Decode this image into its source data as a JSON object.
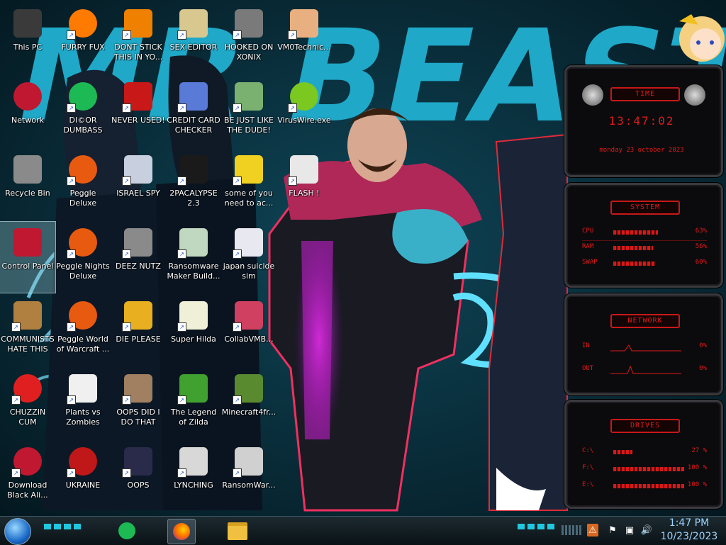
{
  "desktop": {
    "icons": [
      {
        "label": "This PC",
        "icon": "computer-icon",
        "color": "#3a3a3a"
      },
      {
        "label": "FURRY FUX",
        "icon": "firefox-icon",
        "color": "#ff7a00"
      },
      {
        "label": "DONT STICK THIS IN YO...",
        "icon": "vlc-cone-icon",
        "color": "#f08000"
      },
      {
        "label": "SEX EDITOR",
        "icon": "hxd-icon",
        "color": "#d8c890"
      },
      {
        "label": "HOOKED ON XONIX",
        "icon": "xonix-icon",
        "color": "#7a7a7a"
      },
      {
        "label": "VM0Technic...",
        "icon": "doctor-icon",
        "color": "#e8b080"
      },
      {
        "label": "Network",
        "icon": "alien-orb-icon",
        "color": "#c01830"
      },
      {
        "label": "DI©OR DUMBASS",
        "icon": "spotify-icon",
        "color": "#1db954"
      },
      {
        "label": "NEVER USED!",
        "icon": "dev-cpp-icon",
        "color": "#c81818"
      },
      {
        "label": "CREDIT CARD CHECKER",
        "icon": "credit-card-icon",
        "color": "#5a7ad8"
      },
      {
        "label": "BE JUST LIKE THE DUDE!",
        "icon": "dude-icon",
        "color": "#7ab070"
      },
      {
        "label": "VirusWire.exe",
        "icon": "lime-icon",
        "color": "#7ac820"
      },
      {
        "label": "Recycle Bin",
        "icon": "recycle-bin-icon",
        "color": "#8a8a8a"
      },
      {
        "label": "Peggle Deluxe",
        "icon": "peggle-icon",
        "color": "#e85a10"
      },
      {
        "label": "ISRAEL SPY",
        "icon": "scanner-icon",
        "color": "#c8d0e0"
      },
      {
        "label": "2PACALYPSE 2.3",
        "icon": "terminal-icon",
        "color": "#1a1a1a"
      },
      {
        "label": "some of you need to ac...",
        "icon": "beaver-icon",
        "color": "#f0d020"
      },
      {
        "label": "FLASH !",
        "icon": "flash-file-icon",
        "color": "#e8e8e8"
      },
      {
        "label": "Control Panel",
        "icon": "control-panel-icon",
        "color": "#c01830"
      },
      {
        "label": "Peggle Nights Deluxe",
        "icon": "peggle-nights-icon",
        "color": "#e85a10"
      },
      {
        "label": "DEEZ NUTZ",
        "icon": "windows-stack-icon",
        "color": "#8a8a8a"
      },
      {
        "label": "Ransomware Maker Build...",
        "icon": "window-app-icon",
        "color": "#c0d8c0"
      },
      {
        "label": "japan suicide sim",
        "icon": "installer-icon",
        "color": "#e8e8f0"
      },
      {
        "label": "COMMUNISTS HATE THIS G...",
        "icon": "money-bag-icon",
        "color": "#b08040"
      },
      {
        "label": "Peggle World of Warcraft ...",
        "icon": "peggle-wow-icon",
        "color": "#e85a10"
      },
      {
        "label": "DIE PLEASE",
        "icon": "de-icon",
        "color": "#e8b020"
      },
      {
        "label": "Super Hilda",
        "icon": "pixel-hilda-icon",
        "color": "#f0f0d8"
      },
      {
        "label": "CollabVMB...",
        "icon": "monitor-icon",
        "color": "#d04060"
      },
      {
        "label": "CHUZZIN CUM",
        "icon": "chuzzle-icon",
        "color": "#e02020"
      },
      {
        "label": "Plants vs Zombies",
        "icon": "plants-vs-zombies-icon",
        "color": "#f0f0f0"
      },
      {
        "label": "OOPS DID I DO THAT",
        "icon": "portrait-icon",
        "color": "#a08060"
      },
      {
        "label": "The Legend of Zilda",
        "icon": "zelda-icon",
        "color": "#40a030"
      },
      {
        "label": "Minecraft4fr...",
        "icon": "minecraft-icon",
        "color": "#5a8a30"
      },
      {
        "label": "Download Black Ali...",
        "icon": "alien-orb-icon",
        "color": "#c01830"
      },
      {
        "label": "UKRAINE",
        "icon": "radiation-icon",
        "color": "#c01818"
      },
      {
        "label": "OOPS",
        "icon": "book-icon",
        "color": "#2a2a4a"
      },
      {
        "label": "LYNCHING",
        "icon": "flag-lock-icon",
        "color": "#d8d8d8"
      },
      {
        "label": "RansomWar...",
        "icon": "skull-icon",
        "color": "#d0d0d0"
      }
    ]
  },
  "wallpaper": {
    "banner_text": "MR BEAST",
    "accent": "#1fa8c8",
    "glow": "#e030e0"
  },
  "gadgets": {
    "time": {
      "title": "TIME",
      "clock": "13:47:02",
      "date": "monday 23 october 2023"
    },
    "system": {
      "title": "SYSTEM",
      "rows": [
        {
          "label": "CPU",
          "value": "63%",
          "level": 0.63
        },
        {
          "label": "RAM",
          "value": "56%",
          "level": 0.56
        },
        {
          "label": "SWAP",
          "value": "60%",
          "level": 0.6
        }
      ]
    },
    "network": {
      "title": "NETWORK",
      "rows": [
        {
          "label": "IN",
          "value": "0%"
        },
        {
          "label": "OUT",
          "value": "0%"
        }
      ]
    },
    "drives": {
      "title": "DRIVES",
      "rows": [
        {
          "label": "C:\\",
          "value": "27 %",
          "level": 0.27
        },
        {
          "label": "F:\\",
          "value": "100 %",
          "level": 1.0
        },
        {
          "label": "E:\\",
          "value": "100 %",
          "level": 1.0
        }
      ]
    },
    "accent": "#e01a1a"
  },
  "taskbar": {
    "start": "start-orb-icon",
    "pinned": [
      {
        "icon": "spotify-icon",
        "active": false
      },
      {
        "icon": "firefox-icon",
        "active": true
      },
      {
        "icon": "file-explorer-icon",
        "active": false
      }
    ],
    "tray": [
      "shield-icon",
      "flag-icon",
      "network-icon",
      "speaker-icon"
    ],
    "time": "1:47 PM",
    "date": "10/23/2023"
  }
}
